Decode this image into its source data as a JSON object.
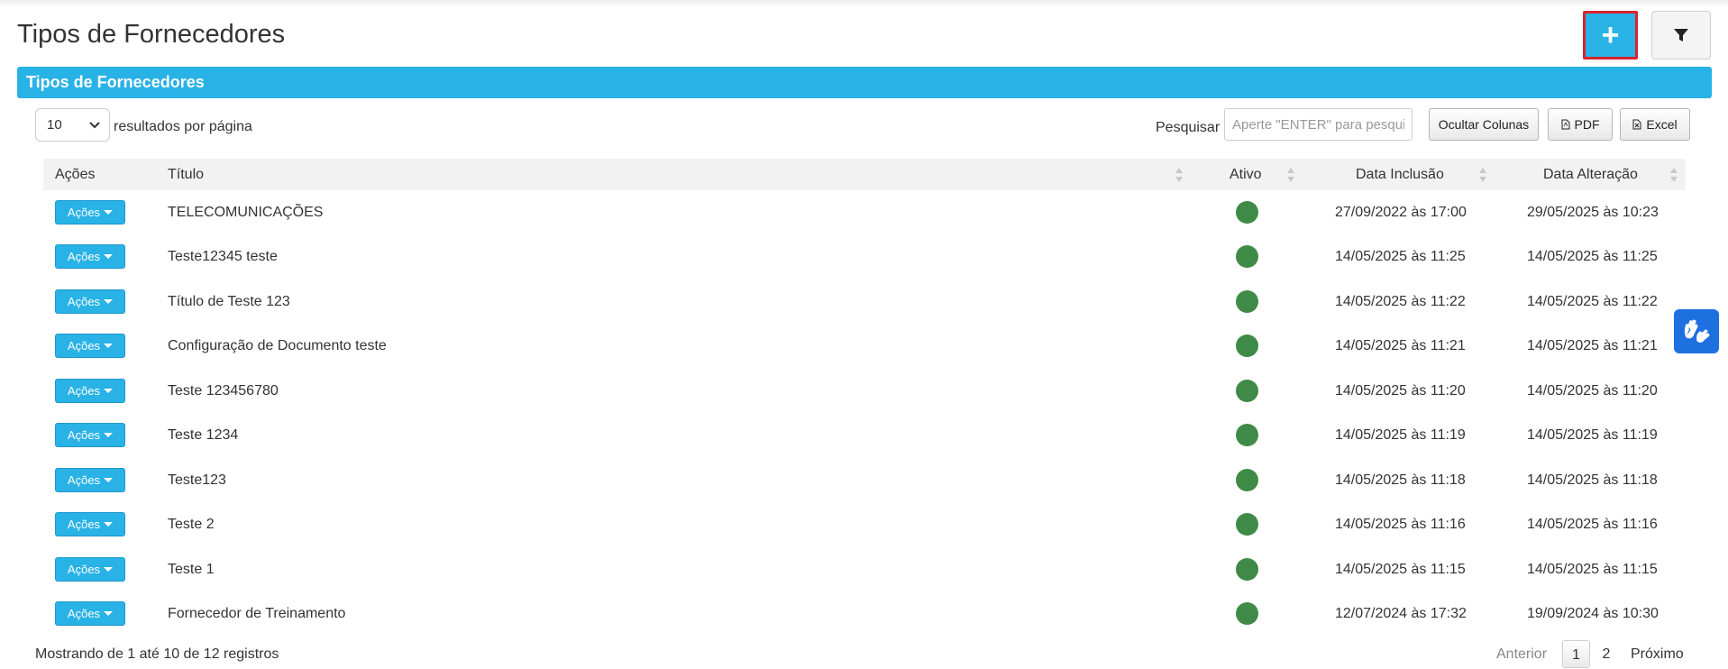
{
  "header": {
    "title": "Tipos de Fornecedores",
    "add_label": "+",
    "filter_icon": "filter-icon"
  },
  "panel": {
    "title": "Tipos de Fornecedores"
  },
  "controls": {
    "page_size": "10",
    "per_page_label": "resultados por página",
    "search_label": "Pesquisar",
    "search_placeholder": "Aperte \"ENTER\" para pesquisar",
    "hide_columns": "Ocultar Colunas",
    "pdf": "PDF",
    "excel": "Excel"
  },
  "table": {
    "headers": [
      "Ações",
      "Título",
      "Ativo",
      "Data Inclusão",
      "Data Alteração"
    ],
    "action_label": "Ações",
    "rows": [
      {
        "titulo": "TELECOMUNICAÇÕES",
        "inclusao": "27/09/2022 às 17:00",
        "alteracao": "29/05/2025 às 10:23"
      },
      {
        "titulo": "Teste12345 teste",
        "inclusao": "14/05/2025 às 11:25",
        "alteracao": "14/05/2025 às 11:25"
      },
      {
        "titulo": "Título de Teste 123",
        "inclusao": "14/05/2025 às 11:22",
        "alteracao": "14/05/2025 às 11:22"
      },
      {
        "titulo": "Configuração de Documento teste",
        "inclusao": "14/05/2025 às 11:21",
        "alteracao": "14/05/2025 às 11:21"
      },
      {
        "titulo": "Teste 123456780",
        "inclusao": "14/05/2025 às 11:20",
        "alteracao": "14/05/2025 às 11:20"
      },
      {
        "titulo": "Teste 1234",
        "inclusao": "14/05/2025 às 11:19",
        "alteracao": "14/05/2025 às 11:19"
      },
      {
        "titulo": "Teste123",
        "inclusao": "14/05/2025 às 11:18",
        "alteracao": "14/05/2025 às 11:18"
      },
      {
        "titulo": "Teste 2",
        "inclusao": "14/05/2025 às 11:16",
        "alteracao": "14/05/2025 às 11:16"
      },
      {
        "titulo": "Teste 1",
        "inclusao": "14/05/2025 às 11:15",
        "alteracao": "14/05/2025 às 11:15"
      },
      {
        "titulo": "Fornecedor de Treinamento",
        "inclusao": "12/07/2024 às 17:32",
        "alteracao": "19/09/2024 às 10:30"
      }
    ]
  },
  "footer": {
    "info": "Mostrando de 1 até 10 de 12 registros",
    "prev": "Anterior",
    "pages": [
      "1",
      "2"
    ],
    "next": "Próximo"
  },
  "colors": {
    "accent": "#29b2e6",
    "active_dot": "#3f8a46",
    "highlight_border": "#d9232d",
    "a11y": "#1e6fe0"
  }
}
